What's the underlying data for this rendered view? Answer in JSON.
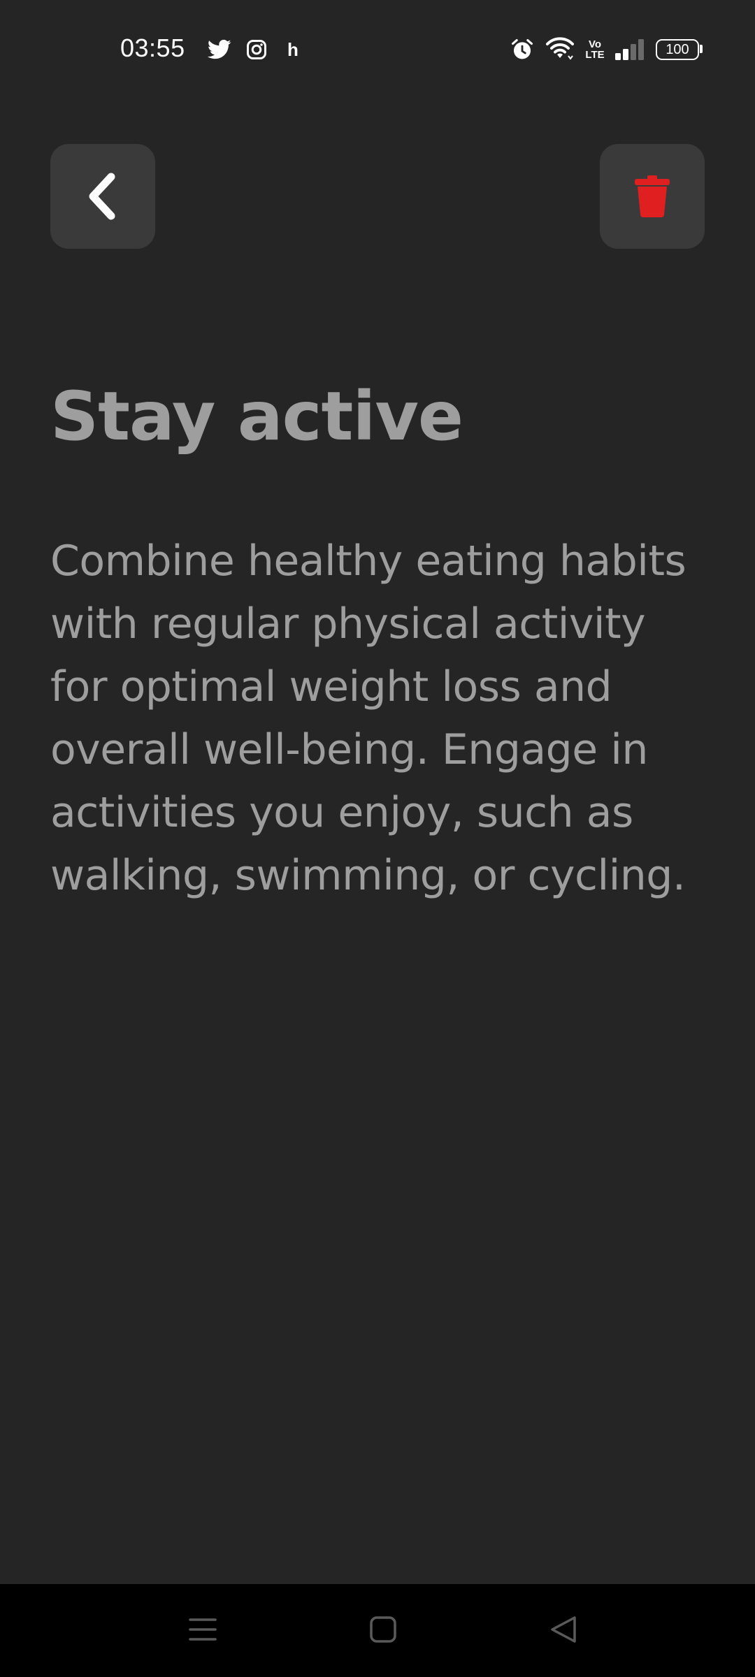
{
  "status_bar": {
    "time": "03:55",
    "notification_letter": "h",
    "volte_top": "Vo",
    "volte_bottom": "LTE",
    "battery_level": "100"
  },
  "toolbar": {
    "back_icon": "chevron-left-icon",
    "delete_icon": "trash-icon",
    "delete_color": "#e02020"
  },
  "note": {
    "title": "Stay active",
    "body": "Combine healthy eating habits with regular physical activity for optimal weight loss and overall well-being. Engage in activities you enjoy, such as walking, swimming, or cycling."
  },
  "colors": {
    "background": "#252525",
    "button_background": "#3a3a3a",
    "text": "#9e9e9e",
    "nav_background": "#000000"
  },
  "nav": {
    "menu_icon": "menu-icon",
    "home_icon": "home-square-icon",
    "back_icon": "back-triangle-icon"
  }
}
